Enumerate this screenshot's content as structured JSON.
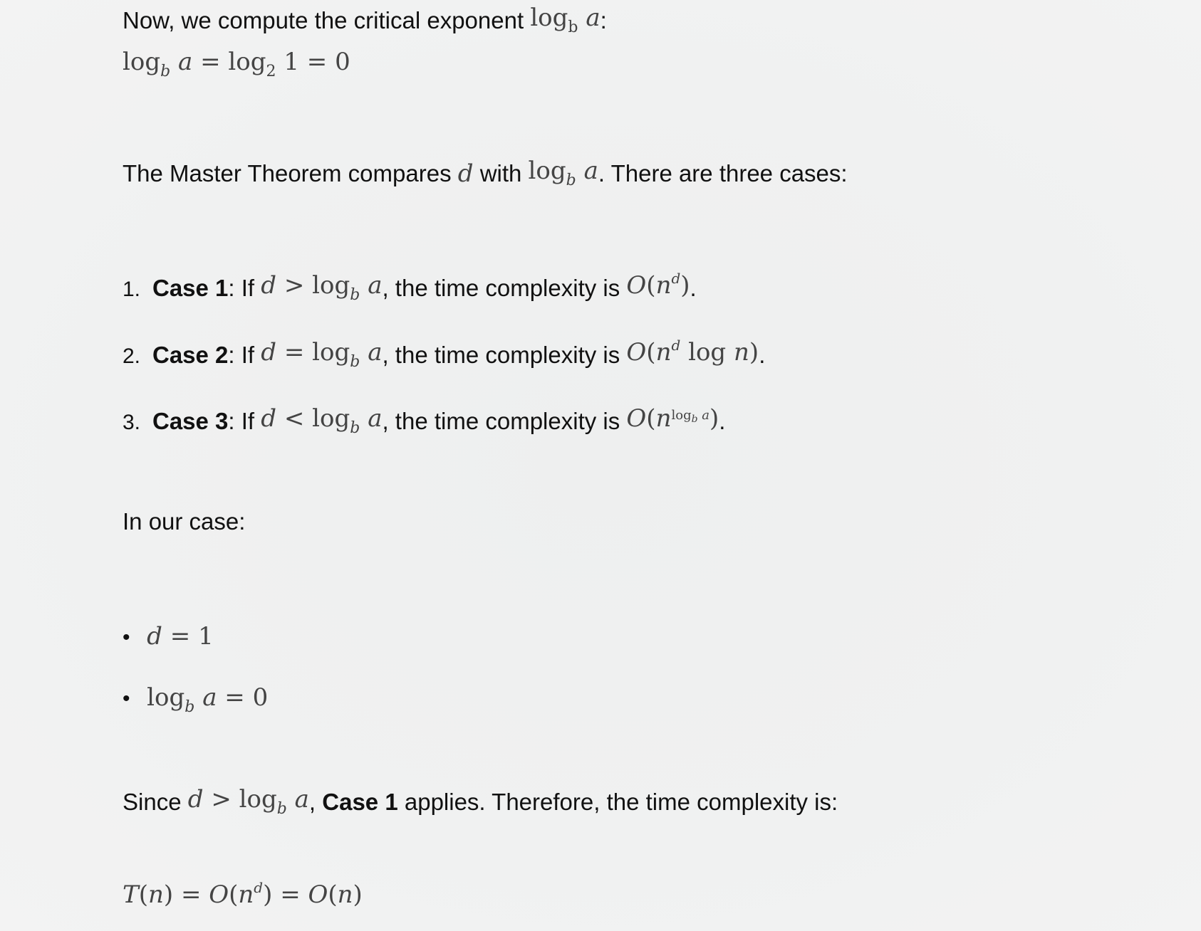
{
  "intro": {
    "text": "Now, we compute the critical exponent",
    "colon": ":"
  },
  "eq1": {
    "lhs": "log",
    "lhs_sub": "b",
    "lhs_var": "a",
    "eq1": "=",
    "mid": "log",
    "mid_sub": "2",
    "mid_arg": "1",
    "eq2": "=",
    "rhs": "0"
  },
  "master": {
    "prefix": "The Master Theorem compares",
    "d": "d",
    "with": "with",
    "suffix": ". There are three cases:"
  },
  "cases": [
    {
      "num": "1.",
      "label": "Case 1",
      "if": ": If",
      "rel": ">",
      "mid": ", the time complexity is",
      "end": "."
    },
    {
      "num": "2.",
      "label": "Case 2",
      "if": ": If",
      "rel": "=",
      "mid": ", the time complexity is",
      "end": "."
    },
    {
      "num": "3.",
      "label": "Case 3",
      "if": ": If",
      "rel": "<",
      "mid": ", the time complexity is",
      "end": "."
    }
  ],
  "our_case": "In our case:",
  "bullets": [
    {
      "marker": "•",
      "lhs": "d",
      "eq": "=",
      "rhs": "1"
    },
    {
      "marker": "•",
      "lhs": "log",
      "sub": "b",
      "var": "a",
      "eq": "=",
      "rhs": "0"
    }
  ],
  "since": {
    "prefix": "Since",
    "rel": ">",
    "comma": ",",
    "label": "Case 1",
    "suffix": "applies. Therefore, the time complexity is:"
  },
  "final": {
    "T": "T",
    "n": "n",
    "eq": "=",
    "O": "O"
  }
}
